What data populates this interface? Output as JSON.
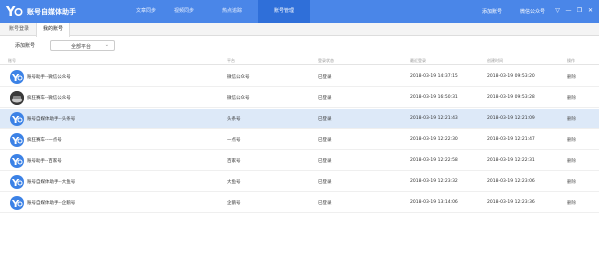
{
  "app": {
    "title": "账号自媒体助手"
  },
  "nav": {
    "items": [
      {
        "label": "文章同步"
      },
      {
        "label": "视频同步"
      },
      {
        "label": "热点追踪"
      },
      {
        "label": "账号管理"
      }
    ],
    "active_index": 3
  },
  "titlebar": {
    "add_account_label": "添加账号",
    "follow_label": "微信公众号",
    "controls": [
      "▽",
      "—",
      "❐",
      "✕"
    ]
  },
  "subtabs": {
    "items": [
      {
        "label": "账号登录"
      },
      {
        "label": "我的账号"
      }
    ],
    "active_index": 1
  },
  "toolbar": {
    "add_label": "添加账号",
    "platform_select_value": "全部平台"
  },
  "table": {
    "headers": {
      "account": "账号",
      "platform": "平台",
      "login_status": "登录状态",
      "last_login": "最近登录",
      "created": "创建时间",
      "action": "操作"
    },
    "rows": [
      {
        "name": "账号助手--微信公众号",
        "platform": "微信公众号",
        "status": "已登录",
        "last_login": "2018-03-19 14:37:15",
        "created": "2018-03-19 09:53:20",
        "action": "删除",
        "avatar": "blue"
      },
      {
        "name": "疯狂赛车--微信公众号",
        "platform": "微信公众号",
        "status": "已登录",
        "last_login": "2018-03-19 16:50:31",
        "created": "2018-03-19 09:53:28",
        "action": "删除",
        "avatar": "dark"
      },
      {
        "name": "账号自媒体助手--头条号",
        "platform": "头条号",
        "status": "已登录",
        "last_login": "2018-03-19 12:21:43",
        "created": "2018-03-19 12:21:09",
        "action": "删除",
        "avatar": "blue"
      },
      {
        "name": "疯狂赛车--一点号",
        "platform": "一点号",
        "status": "已登录",
        "last_login": "2018-03-19 12:22:30",
        "created": "2018-03-19 12:21:47",
        "action": "删除",
        "avatar": "blue"
      },
      {
        "name": "账号助手--百家号",
        "platform": "百家号",
        "status": "已登录",
        "last_login": "2018-03-19 12:22:58",
        "created": "2018-03-19 12:22:31",
        "action": "删除",
        "avatar": "blue"
      },
      {
        "name": "账号自媒体助手--大鱼号",
        "platform": "大鱼号",
        "status": "已登录",
        "last_login": "2018-03-19 12:23:32",
        "created": "2018-03-19 12:23:06",
        "action": "删除",
        "avatar": "blue"
      },
      {
        "name": "账号自媒体助手--企鹅号",
        "platform": "企鹅号",
        "status": "已登录",
        "last_login": "2018-03-19 13:14:06",
        "created": "2018-03-19 12:23:36",
        "action": "删除",
        "avatar": "blue"
      }
    ],
    "selected_index": 2
  },
  "colors": {
    "header_bg": "#4a86e8",
    "nav_active_bg": "#2f6fd9",
    "selected_row_bg": "#dde9f8"
  }
}
